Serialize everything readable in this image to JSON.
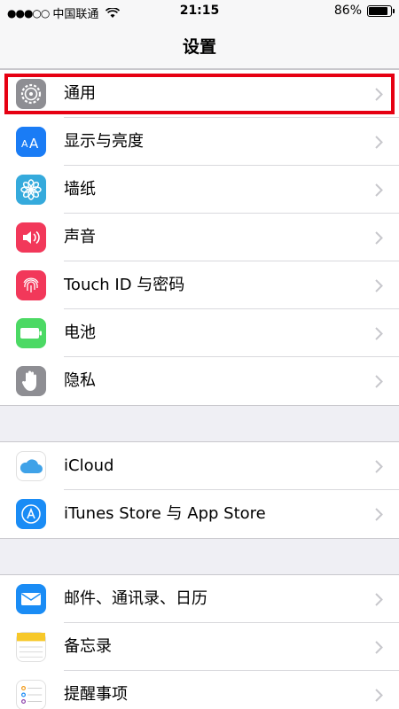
{
  "status_bar": {
    "signal": "●●●○○",
    "carrier": "中国联通",
    "time": "21:15",
    "battery": "86%",
    "battery_level": 0.86
  },
  "nav": {
    "title": "设置"
  },
  "groups": [
    {
      "items": [
        {
          "label": "通用",
          "icon": "gear-icon",
          "color": "#8e8e93"
        },
        {
          "label": "显示与亮度",
          "icon": "display-brightness-icon",
          "color": "#1a7cf5"
        },
        {
          "label": "墙纸",
          "icon": "wallpaper-flower-icon",
          "color": "#35aadc"
        },
        {
          "label": "声音",
          "icon": "speaker-icon",
          "color": "#f2385a"
        },
        {
          "label": "Touch ID 与密码",
          "icon": "fingerprint-icon",
          "color": "#f2385a"
        },
        {
          "label": "电池",
          "icon": "battery-icon",
          "color": "#4cd964"
        },
        {
          "label": "隐私",
          "icon": "hand-icon",
          "color": "#8e8e93"
        }
      ]
    },
    {
      "items": [
        {
          "label": "iCloud",
          "icon": "cloud-icon",
          "color": "#ffffff"
        },
        {
          "label": "iTunes Store 与 App Store",
          "icon": "app-store-icon",
          "color": "#1a8cf5"
        }
      ]
    },
    {
      "items": [
        {
          "label": "邮件、通讯录、日历",
          "icon": "mail-icon",
          "color": "#1a8cf5"
        },
        {
          "label": "备忘录",
          "icon": "notes-icon",
          "color": "#ffffff"
        },
        {
          "label": "提醒事项",
          "icon": "reminders-icon",
          "color": "#ffffff"
        }
      ]
    }
  ]
}
